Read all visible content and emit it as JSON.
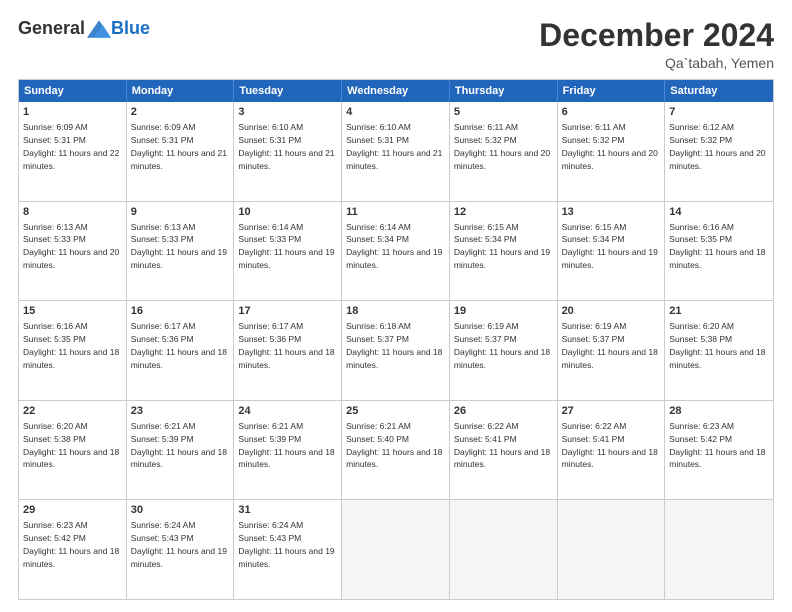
{
  "header": {
    "logo": {
      "general": "General",
      "blue": "Blue",
      "tagline": ""
    },
    "title": "December 2024",
    "location": "Qa`tabah, Yemen"
  },
  "calendar": {
    "days_of_week": [
      "Sunday",
      "Monday",
      "Tuesday",
      "Wednesday",
      "Thursday",
      "Friday",
      "Saturday"
    ],
    "weeks": [
      [
        {
          "day": "",
          "empty": true
        },
        {
          "day": "",
          "empty": true
        },
        {
          "day": "",
          "empty": true
        },
        {
          "day": "",
          "empty": true
        },
        {
          "day": "",
          "empty": true
        },
        {
          "day": "",
          "empty": true
        },
        {
          "day": "",
          "empty": true
        }
      ],
      [
        {
          "day": "1",
          "sunrise": "6:09 AM",
          "sunset": "5:31 PM",
          "daylight": "11 hours and 22 minutes."
        },
        {
          "day": "2",
          "sunrise": "6:09 AM",
          "sunset": "5:31 PM",
          "daylight": "11 hours and 21 minutes."
        },
        {
          "day": "3",
          "sunrise": "6:10 AM",
          "sunset": "5:31 PM",
          "daylight": "11 hours and 21 minutes."
        },
        {
          "day": "4",
          "sunrise": "6:10 AM",
          "sunset": "5:31 PM",
          "daylight": "11 hours and 21 minutes."
        },
        {
          "day": "5",
          "sunrise": "6:11 AM",
          "sunset": "5:32 PM",
          "daylight": "11 hours and 20 minutes."
        },
        {
          "day": "6",
          "sunrise": "6:11 AM",
          "sunset": "5:32 PM",
          "daylight": "11 hours and 20 minutes."
        },
        {
          "day": "7",
          "sunrise": "6:12 AM",
          "sunset": "5:32 PM",
          "daylight": "11 hours and 20 minutes."
        }
      ],
      [
        {
          "day": "8",
          "sunrise": "6:13 AM",
          "sunset": "5:33 PM",
          "daylight": "11 hours and 20 minutes."
        },
        {
          "day": "9",
          "sunrise": "6:13 AM",
          "sunset": "5:33 PM",
          "daylight": "11 hours and 19 minutes."
        },
        {
          "day": "10",
          "sunrise": "6:14 AM",
          "sunset": "5:33 PM",
          "daylight": "11 hours and 19 minutes."
        },
        {
          "day": "11",
          "sunrise": "6:14 AM",
          "sunset": "5:34 PM",
          "daylight": "11 hours and 19 minutes."
        },
        {
          "day": "12",
          "sunrise": "6:15 AM",
          "sunset": "5:34 PM",
          "daylight": "11 hours and 19 minutes."
        },
        {
          "day": "13",
          "sunrise": "6:15 AM",
          "sunset": "5:34 PM",
          "daylight": "11 hours and 19 minutes."
        },
        {
          "day": "14",
          "sunrise": "6:16 AM",
          "sunset": "5:35 PM",
          "daylight": "11 hours and 18 minutes."
        }
      ],
      [
        {
          "day": "15",
          "sunrise": "6:16 AM",
          "sunset": "5:35 PM",
          "daylight": "11 hours and 18 minutes."
        },
        {
          "day": "16",
          "sunrise": "6:17 AM",
          "sunset": "5:36 PM",
          "daylight": "11 hours and 18 minutes."
        },
        {
          "day": "17",
          "sunrise": "6:17 AM",
          "sunset": "5:36 PM",
          "daylight": "11 hours and 18 minutes."
        },
        {
          "day": "18",
          "sunrise": "6:18 AM",
          "sunset": "5:37 PM",
          "daylight": "11 hours and 18 minutes."
        },
        {
          "day": "19",
          "sunrise": "6:19 AM",
          "sunset": "5:37 PM",
          "daylight": "11 hours and 18 minutes."
        },
        {
          "day": "20",
          "sunrise": "6:19 AM",
          "sunset": "5:37 PM",
          "daylight": "11 hours and 18 minutes."
        },
        {
          "day": "21",
          "sunrise": "6:20 AM",
          "sunset": "5:38 PM",
          "daylight": "11 hours and 18 minutes."
        }
      ],
      [
        {
          "day": "22",
          "sunrise": "6:20 AM",
          "sunset": "5:38 PM",
          "daylight": "11 hours and 18 minutes."
        },
        {
          "day": "23",
          "sunrise": "6:21 AM",
          "sunset": "5:39 PM",
          "daylight": "11 hours and 18 minutes."
        },
        {
          "day": "24",
          "sunrise": "6:21 AM",
          "sunset": "5:39 PM",
          "daylight": "11 hours and 18 minutes."
        },
        {
          "day": "25",
          "sunrise": "6:21 AM",
          "sunset": "5:40 PM",
          "daylight": "11 hours and 18 minutes."
        },
        {
          "day": "26",
          "sunrise": "6:22 AM",
          "sunset": "5:41 PM",
          "daylight": "11 hours and 18 minutes."
        },
        {
          "day": "27",
          "sunrise": "6:22 AM",
          "sunset": "5:41 PM",
          "daylight": "11 hours and 18 minutes."
        },
        {
          "day": "28",
          "sunrise": "6:23 AM",
          "sunset": "5:42 PM",
          "daylight": "11 hours and 18 minutes."
        }
      ],
      [
        {
          "day": "29",
          "sunrise": "6:23 AM",
          "sunset": "5:42 PM",
          "daylight": "11 hours and 18 minutes."
        },
        {
          "day": "30",
          "sunrise": "6:24 AM",
          "sunset": "5:43 PM",
          "daylight": "11 hours and 19 minutes."
        },
        {
          "day": "31",
          "sunrise": "6:24 AM",
          "sunset": "5:43 PM",
          "daylight": "11 hours and 19 minutes."
        },
        {
          "day": "",
          "empty": true
        },
        {
          "day": "",
          "empty": true
        },
        {
          "day": "",
          "empty": true
        },
        {
          "day": "",
          "empty": true
        }
      ]
    ]
  }
}
